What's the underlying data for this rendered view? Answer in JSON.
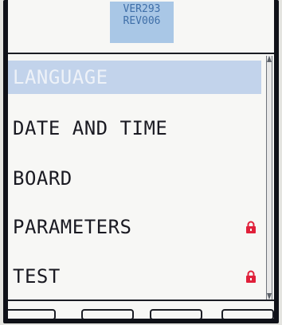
{
  "header": {
    "version": "VER293",
    "revision": "REV006"
  },
  "menu": {
    "items": [
      {
        "label": "LANGUAGE",
        "selected": true,
        "locked": false
      },
      {
        "label": "DATE AND TIME",
        "selected": false,
        "locked": false
      },
      {
        "label": "BOARD",
        "selected": false,
        "locked": false
      },
      {
        "label": "PARAMETERS",
        "selected": false,
        "locked": true
      },
      {
        "label": "TEST",
        "selected": false,
        "locked": true
      }
    ]
  },
  "colors": {
    "selection": "#c2d3eb",
    "lock": "#e0203a",
    "version_bg": "#a9c7e6",
    "version_text": "#3f6fa8"
  },
  "icons": {
    "lock": "padlock-icon"
  }
}
